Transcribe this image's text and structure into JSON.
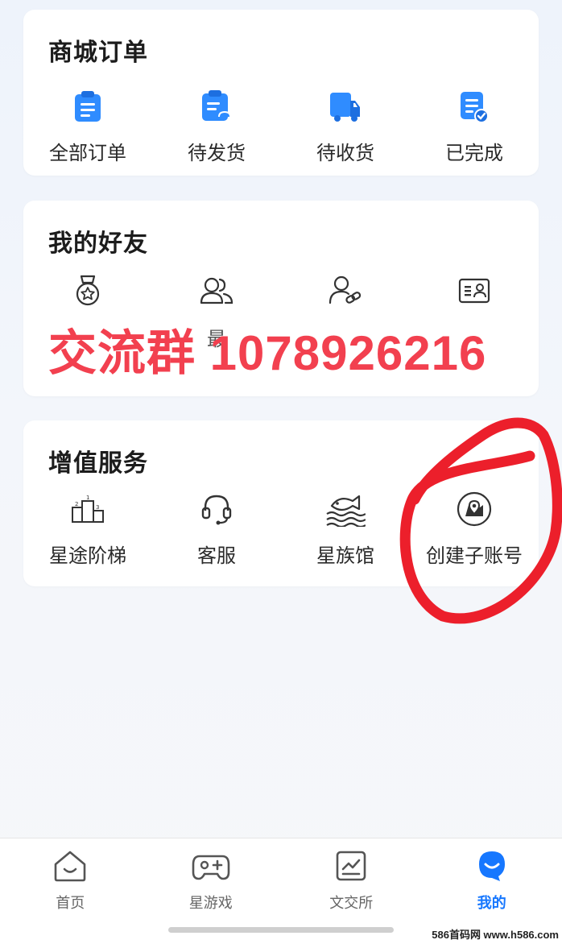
{
  "orders": {
    "title": "商城订单",
    "items": [
      {
        "label": "全部订单",
        "icon": "all-orders-icon"
      },
      {
        "label": "待发货",
        "icon": "pending-shipment-icon"
      },
      {
        "label": "待收货",
        "icon": "delivery-truck-icon"
      },
      {
        "label": "已完成",
        "icon": "completed-order-icon"
      }
    ],
    "accent": "#2f8cff"
  },
  "friends": {
    "title": "我的好友",
    "items": [
      {
        "label": "",
        "icon": "medal-icon"
      },
      {
        "label": "最",
        "icon": "friends-group-icon"
      },
      {
        "label": "",
        "icon": "user-link-icon"
      },
      {
        "label": "",
        "icon": "id-card-icon"
      }
    ]
  },
  "services": {
    "title": "增值服务",
    "items": [
      {
        "label": "星途阶梯",
        "icon": "podium-icon"
      },
      {
        "label": "客服",
        "icon": "headset-icon"
      },
      {
        "label": "星族馆",
        "icon": "fish-icon"
      },
      {
        "label": "创建子账号",
        "icon": "location-badge-icon"
      }
    ]
  },
  "overlay": {
    "text": "交流群 1078926216",
    "color": "#f2404f"
  },
  "tabbar": {
    "tabs": [
      {
        "label": "首页",
        "icon": "home-icon",
        "active": false
      },
      {
        "label": "星游戏",
        "icon": "gamepad-icon",
        "active": false
      },
      {
        "label": "文交所",
        "icon": "chart-doc-icon",
        "active": false
      },
      {
        "label": "我的",
        "icon": "profile-icon",
        "active": true
      }
    ],
    "active_color": "#1677ff"
  },
  "watermark": "586首码网 www.h586.com"
}
